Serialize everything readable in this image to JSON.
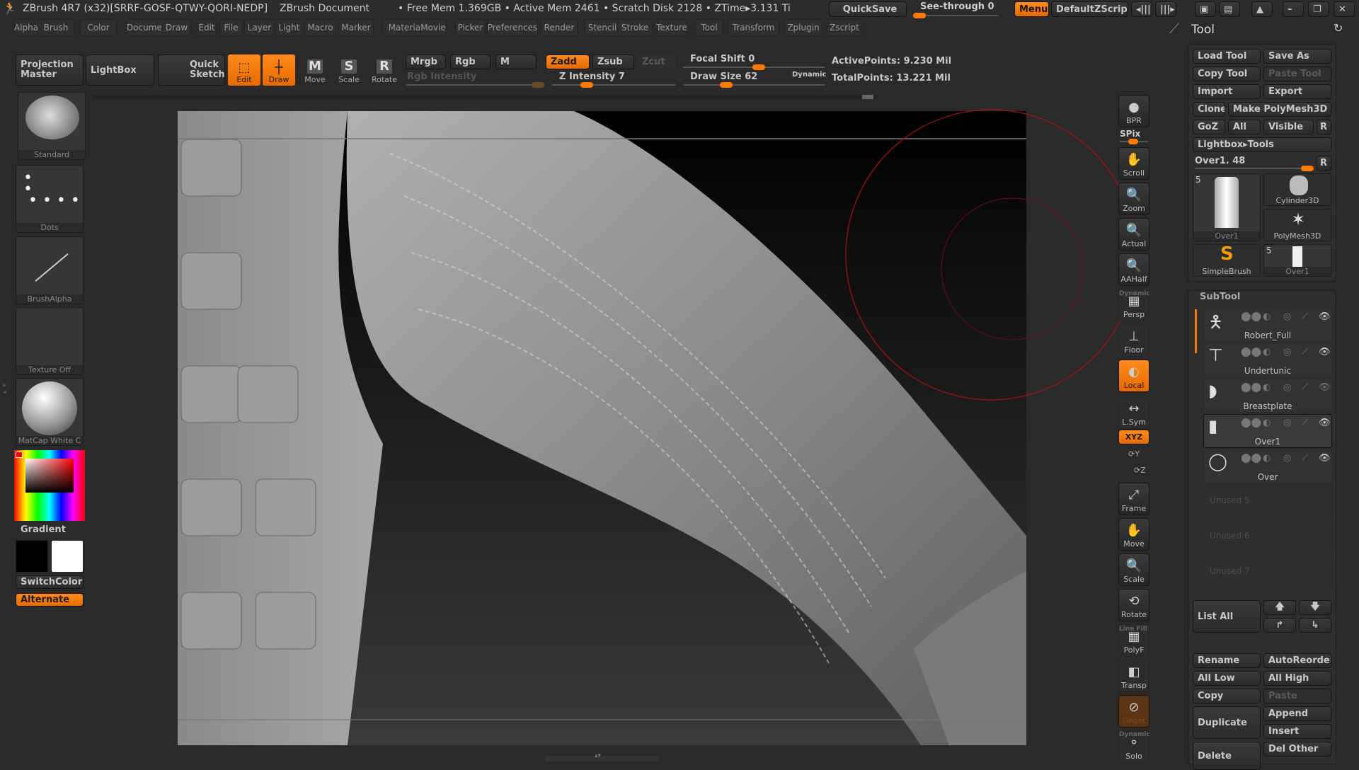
{
  "title_bar": {
    "app_title": "ZBrush 4R7 (x32)[SRRF-GOSF-QTWY-QORI-NEDP]",
    "document": "ZBrush Document",
    "stats": "• Free Mem 1.369GB • Active Mem 2461 • Scratch Disk 2128 • ZTime▸3.131 Ti",
    "quicksave": "QuickSave",
    "see_through": "See-through  0",
    "see_through_value": 0,
    "menus": "Menus",
    "default_zscript": "DefaultZScript"
  },
  "menu_bar": [
    "Alpha",
    "Brush",
    "Color",
    "Document",
    "Draw",
    "Edit",
    "File",
    "Layer",
    "Light",
    "Macro",
    "Marker",
    "Material",
    "Movie",
    "Picker",
    "Preferences",
    "Render",
    "Stencil",
    "Stroke",
    "Texture",
    "Tool",
    "Transform",
    "Zplugin",
    "Zscript"
  ],
  "top_shelf": {
    "projection_master": "Projection Master",
    "lightbox": "LightBox",
    "quick_sketch": "Quick Sketch",
    "edit": "Edit",
    "draw": "Draw",
    "move": "Move",
    "scale": "Scale",
    "rotate": "Rotate",
    "mrgb": "Mrgb",
    "rgb": "Rgb",
    "m": "M",
    "zadd": "Zadd",
    "zsub": "Zsub",
    "zcut": "Zcut",
    "rgb_intensity": "Rgb Intensity",
    "z_intensity": "Z Intensity 7",
    "z_intensity_value": 7,
    "focal_shift": "Focal Shift 0",
    "focal_shift_value": 0,
    "draw_size": "Draw Size 62",
    "draw_size_value": 62,
    "dynamic": "Dynamic",
    "active_points": "ActivePoints: 9.230 Mil",
    "total_points": "TotalPoints: 13.221 Mil"
  },
  "left_shelf": {
    "brush": "Standard",
    "stroke": "Dots",
    "alpha": "BrushAlpha",
    "texture": "Texture Off",
    "material": "MatCap White C",
    "gradient": "Gradient",
    "switch_color": "SwitchColor",
    "alternate": "Alternate",
    "main_color": "#ff0000"
  },
  "right_shelf": [
    {
      "label": "BPR",
      "icon": "bpr-sphere-icon"
    },
    {
      "label": "SPix",
      "icon": "spix-slider"
    },
    {
      "label": "Scroll",
      "icon": "hand-icon"
    },
    {
      "label": "Zoom",
      "icon": "zoom-icon"
    },
    {
      "label": "Actual",
      "icon": "actual-icon"
    },
    {
      "label": "AAHalf",
      "icon": "aahalf-icon"
    },
    {
      "label": "Persp",
      "icon": "persp-grid-icon"
    },
    {
      "label": "Floor",
      "icon": "floor-icon"
    },
    {
      "label": "Local",
      "icon": "local-icon"
    },
    {
      "label": "L.Sym",
      "icon": "lsym-icon"
    },
    {
      "label": "XYZ",
      "icon": "xyz-rotate-icon"
    },
    {
      "label": "Frame",
      "icon": "frame-icon"
    },
    {
      "label": "Move",
      "icon": "move-hand-icon"
    },
    {
      "label": "Scale",
      "icon": "scale-icon"
    },
    {
      "label": "Rotate",
      "icon": "rotate-icon"
    },
    {
      "label": "PolyF",
      "icon": "polyf-icon"
    },
    {
      "label": "Transp",
      "icon": "transp-icon"
    },
    {
      "label": "Ghost",
      "icon": "ghost-icon"
    },
    {
      "label": "Solo",
      "icon": "solo-icon"
    }
  ],
  "right_shelf_extra": {
    "persp_dynamic": "Dynamic",
    "polyf_line_fill": "Line Fill",
    "solo_dynamic": "Dynamic",
    "y": "Y",
    "z": "Z"
  },
  "tool_panel": {
    "title": "Tool",
    "load_tool": "Load Tool",
    "save_as": "Save As",
    "copy_tool": "Copy Tool",
    "paste_tool": "Paste Tool",
    "import": "Import",
    "export": "Export",
    "clone": "Clone",
    "make_polymesh": "Make PolyMesh3D",
    "goz": "GoZ",
    "all": "All",
    "visible": "Visible",
    "r": "R",
    "lightbox_tools": "Lightbox▸Tools",
    "current_tool": "Over1. 48",
    "current_tool_value": 48,
    "thumbs": [
      {
        "label": "Over1",
        "count": "5"
      },
      {
        "label": "Cylinder3D"
      },
      {
        "label": "PolyMesh3D"
      },
      {
        "label": "SimpleBrush"
      },
      {
        "label": "Over1",
        "count": "5"
      }
    ]
  },
  "subtool": {
    "title": "SubTool",
    "items": [
      {
        "name": "Robert_Full"
      },
      {
        "name": "Undertunic"
      },
      {
        "name": "Breastplate"
      },
      {
        "name": "Over1",
        "selected": true
      },
      {
        "name": "Over"
      },
      {
        "name": "Unused 5"
      },
      {
        "name": "Unused 6"
      },
      {
        "name": "Unused 7"
      }
    ],
    "list_all": "List All",
    "rename": "Rename",
    "autoreorder": "AutoReorder",
    "all_low": "All Low",
    "all_high": "All High",
    "copy": "Copy",
    "paste": "Paste",
    "duplicate": "Duplicate",
    "append": "Append",
    "insert": "Insert",
    "delete": "Delete",
    "del_other": "Del Other"
  },
  "colors": {
    "accent": "#ff7a00",
    "brush_cursor": "#b01010"
  }
}
